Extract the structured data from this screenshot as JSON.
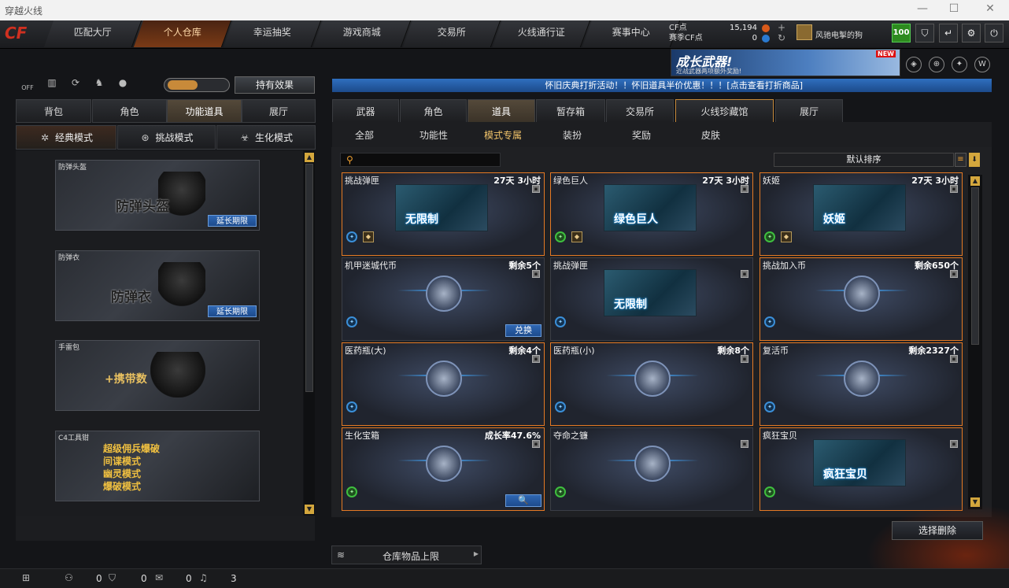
{
  "window": {
    "title": "穿越火线",
    "controls": [
      "—",
      "☐",
      "✕"
    ]
  },
  "logo": {
    "text_cf": "CF",
    "brand": "crossfire"
  },
  "topnav": {
    "tabs": [
      "匹配大厅",
      "个人仓库",
      "幸运抽奖",
      "游戏商城",
      "交易所",
      "火线通行证",
      "赛事中心"
    ],
    "active": "个人仓库"
  },
  "points": {
    "cf_label": "CF点",
    "cf_value": "15,194",
    "season_label": "赛季CF点",
    "season_value": "0"
  },
  "user": {
    "name": "风驰电掣的狗",
    "level": "100"
  },
  "top_buttons": {
    "shield": "⛉",
    "back": "↵",
    "settings": "⚙",
    "power": "⏻"
  },
  "banner": {
    "title": "成长武器!",
    "subtitle": "近战武器两项额外奖励!",
    "badge": "NEW"
  },
  "left_icons": {
    "off_label": "OFF"
  },
  "hold_effect_button": "持有效果",
  "notice": "怀旧庆典打折活动！！怀旧道具半价优惠！！！[点击查看打折商品]",
  "left_tabs": [
    "背包",
    "角色",
    "功能道具",
    "展厅"
  ],
  "left_active": "功能道具",
  "modes": [
    {
      "label": "经典模式",
      "icon": "✲"
    },
    {
      "label": "挑战模式",
      "icon": "⊛"
    },
    {
      "label": "生化模式",
      "icon": "☣"
    }
  ],
  "equip_slots": [
    {
      "label": "防弹头盔",
      "big": "防弹头盔",
      "button": "延长期限"
    },
    {
      "label": "防弹衣",
      "big": "防弹衣",
      "button": "延长期限"
    },
    {
      "label": "手雷包",
      "big": "+携带数"
    },
    {
      "label": "C4工具钳",
      "modes": [
        "超级佣兵爆破",
        "间谍模式",
        "幽灵模式",
        "爆破模式"
      ]
    }
  ],
  "right_tabs": [
    "武器",
    "角色",
    "道具",
    "暂存箱",
    "交易所",
    "火线珍藏馆",
    "展厅"
  ],
  "right_active": "道具",
  "sub_tabs": [
    "全部",
    "功能性",
    "模式专属",
    "装扮",
    "奖励",
    "皮肤"
  ],
  "sub_active": "模式专属",
  "sort": {
    "label": "默认排序",
    "list_icon": "≡",
    "arrow": "⬇"
  },
  "items": [
    {
      "name": "挑战弹匣",
      "info": "27天 3小时",
      "pic_label": "无限制",
      "highlight": true
    },
    {
      "name": "绿色巨人",
      "info": "27天 3小时",
      "pic_label": "绿色巨人",
      "highlight": true
    },
    {
      "name": "妖姬",
      "info": "27天 3小时",
      "pic_label": "妖姬",
      "highlight": true
    },
    {
      "name": "机甲迷城代币",
      "info": "剩余5个",
      "action": "兑换",
      "highlight": false
    },
    {
      "name": "挑战弹匣",
      "info": "",
      "pic_label": "无限制",
      "highlight": false
    },
    {
      "name": "挑战加入币",
      "info": "剩余650个",
      "highlight": true
    },
    {
      "name": "医药瓶(大)",
      "info": "剩余4个",
      "highlight": true
    },
    {
      "name": "医药瓶(小)",
      "info": "剩余8个",
      "highlight": true
    },
    {
      "name": "复活币",
      "info": "剩余2327个",
      "highlight": true
    },
    {
      "name": "生化宝箱",
      "info": "成长率47.6%",
      "action": "🔍",
      "highlight": true
    },
    {
      "name": "夺命之镰",
      "info": "",
      "highlight": false
    },
    {
      "name": "疯狂宝贝",
      "info": "",
      "pic_label": "疯狂宝贝",
      "highlight": true
    }
  ],
  "select_remove_button": "选择删除",
  "warehouse_limit": "仓库物品上限",
  "statusbar": {
    "val1": "0",
    "val2": "0",
    "val3": "0",
    "val4": "3"
  }
}
